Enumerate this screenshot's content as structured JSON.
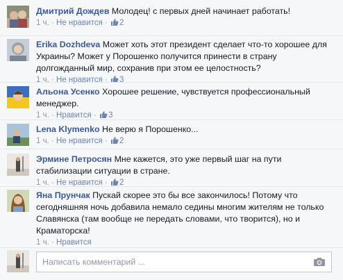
{
  "comments": [
    {
      "author": "Дмитрий Дождев",
      "text": "Молодец! с первых дней начинает работать!",
      "time": "1 ч.",
      "sep1": " · ",
      "like_action": "Не нравится",
      "sep2": " · ",
      "likes": "2",
      "avatar_icon": "profile-photo"
    },
    {
      "author": "Erika Dozhdeva",
      "text": "Может хоть этот президент сделает что-то хорошее для Украины? Может у Порошенко получится принести в страну долгожданный мир, сохранив при этом ее целостность?",
      "time": "1 ч.",
      "sep1": " · ",
      "like_action": "Не нравится",
      "sep2": " · ",
      "likes": "3",
      "avatar_icon": "profile-photo"
    },
    {
      "author": "Альона Усенко",
      "text": "Хорошее решение, чувствуется профессиональный менеджер.",
      "time": "1 ч.",
      "sep1": " · ",
      "like_action": "Нравится",
      "sep2": " · ",
      "likes": "3",
      "avatar_icon": "profile-photo"
    },
    {
      "author": "Lena Klymenko",
      "text": "Не верю я Порошенко...",
      "time": "1 ч.",
      "sep1": " · ",
      "like_action": "Не нравится",
      "sep2": " · ",
      "likes": "2",
      "avatar_icon": "profile-photo"
    },
    {
      "author": "Эрмине Петросян",
      "text": "Мне кажется, это уже первый шаг на пути стабилизации ситуации в стране.",
      "time": "1 ч.",
      "sep1": " · ",
      "like_action": "Не нравится",
      "sep2": " · ",
      "likes": "2",
      "avatar_icon": "profile-photo"
    },
    {
      "author": "Яна Прунчак",
      "text": "Пускай скорее это бы все закончилось! Потому что сегодняшняя ночь добавила немало седины многим жителям не только Славянска (там вообще не передать словами, что творится), но и Краматорска!",
      "time": "1 ч.",
      "sep1": " · ",
      "like_action": "Нравится",
      "sep2": "",
      "likes": "",
      "avatar_icon": "profile-photo"
    }
  ],
  "composer": {
    "placeholder": "Написать комментарий ...",
    "value": "",
    "camera_icon": "camera-icon"
  },
  "colors": {
    "author": "#3b5998",
    "link": "#6d84b4",
    "meta": "#9197a3",
    "background": "#f6f7f9",
    "divider": "#e5e6e9"
  }
}
